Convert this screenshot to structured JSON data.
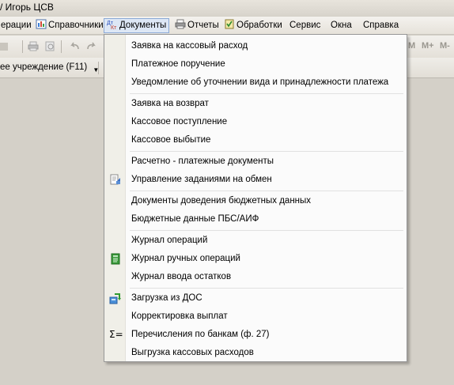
{
  "window": {
    "title": "/ Игорь ЦСВ"
  },
  "menubar": {
    "items": [
      {
        "label": "ерации"
      },
      {
        "label": "Справочники"
      },
      {
        "label": "Документы"
      },
      {
        "label": "Отчеты"
      },
      {
        "label": "Обработки"
      },
      {
        "label": "Сервис"
      },
      {
        "label": "Окна"
      },
      {
        "label": "Справка"
      }
    ]
  },
  "toolbar": {
    "calc_buttons": [
      "M",
      "M+",
      "M-"
    ],
    "organization": "ее учреждение (F11)"
  },
  "documents_menu": {
    "items": [
      {
        "label": "Заявка на кассовый расход",
        "icon": ""
      },
      {
        "label": "Платежное поручение",
        "icon": ""
      },
      {
        "label": "Уведомление об уточнении вида и принадлежности платежа",
        "icon": ""
      },
      {
        "label": "Заявка на возврат",
        "icon": ""
      },
      {
        "label": "Кассовое поступление",
        "icon": ""
      },
      {
        "label": "Кассовое выбытие",
        "icon": ""
      },
      {
        "label": "Расчетно - платежные документы",
        "icon": ""
      },
      {
        "label": "Управление заданиями на обмен",
        "icon": "exchange-tasks-icon"
      },
      {
        "label": "Документы доведения бюджетных данных",
        "icon": ""
      },
      {
        "label": "Бюджетные данные ПБС/АИФ",
        "icon": ""
      },
      {
        "label": "Журнал операций",
        "icon": ""
      },
      {
        "label": "Журнал ручных операций",
        "icon": "green-journal-icon"
      },
      {
        "label": "Журнал ввода остатков",
        "icon": ""
      },
      {
        "label": "Загрузка из ДОС",
        "icon": "import-dos-icon"
      },
      {
        "label": "Корректировка выплат",
        "icon": ""
      },
      {
        "label": "Перечисления по банкам (ф. 27)",
        "icon": "sigma-icon"
      },
      {
        "label": "Выгрузка кассовых расходов",
        "icon": ""
      }
    ]
  }
}
